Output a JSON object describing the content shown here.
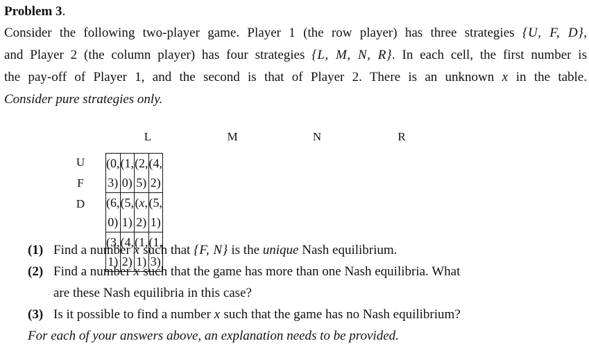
{
  "problem": {
    "title": "Problem 3",
    "title_suffix": ".",
    "intro_lines": [
      {
        "a": "Consider the following two-player game. Player 1 (the row player) has three strategies ",
        "m": "{U, F, D}",
        "b": ","
      },
      {
        "a": "and Player 2 (the column player) has four strategies ",
        "m": "{L, M, N, R}",
        "b": ". In each cell, the first number is"
      },
      {
        "a": "the pay-off of Player 1, and the second is that of Player 2. There is an unknown ",
        "m": "x",
        "b": " in the table."
      }
    ],
    "intro_italic": "Consider pure strategies only."
  },
  "game_table": {
    "columns": [
      "L",
      "M",
      "N",
      "R"
    ],
    "rows": [
      {
        "label": "U",
        "cells": [
          "(0, 3)",
          "(1, 0)",
          "(2, 5)",
          "(4, 2)"
        ]
      },
      {
        "label": "F",
        "cells": [
          "(6, 0)",
          "(5, 1)",
          "(x, 2)",
          "(5, 1)"
        ]
      },
      {
        "label": "D",
        "cells": [
          "(3, 1)",
          "(4, 2)",
          "(1, 1)",
          "(1, 3)"
        ]
      }
    ]
  },
  "questions": [
    {
      "num": "(1)",
      "a": "Find a number ",
      "m1": "x",
      "b": " such that ",
      "m2": "{F, N}",
      "c": " is the ",
      "it": "unique",
      "d": " Nash equilibrium."
    },
    {
      "num": "(2)",
      "a": "Find a number ",
      "m1": "x",
      "b": " such that the game has more than one Nash equilibria. What",
      "cont": "are these Nash equilibria in this case?"
    },
    {
      "num": "(3)",
      "a": "Is it possible to find a number ",
      "m1": "x",
      "b": " such that the game has no Nash equilibrium?"
    }
  ],
  "footer_note": "For each of your answers above, an explanation needs to be provided."
}
